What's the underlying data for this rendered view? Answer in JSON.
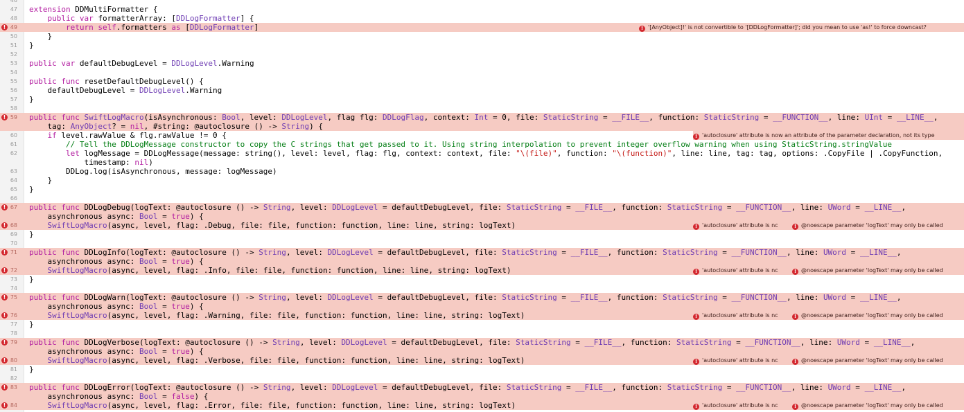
{
  "lines": [
    {
      "n": "46",
      "code": ""
    },
    {
      "n": "47",
      "code": "extension DDMultiFormatter {"
    },
    {
      "n": "48",
      "code": "    public var formatterArray: [DDLogFormatter] {"
    },
    {
      "n": "49",
      "code": "        return self.formatters as [DDLogFormatter]"
    },
    {
      "n": "50",
      "code": "    }"
    },
    {
      "n": "51",
      "code": "}"
    },
    {
      "n": "52",
      "code": ""
    },
    {
      "n": "53",
      "code": "public var defaultDebugLevel = DDLogLevel.Warning"
    },
    {
      "n": "54",
      "code": ""
    },
    {
      "n": "55",
      "code": "public func resetDefaultDebugLevel() {"
    },
    {
      "n": "56",
      "code": "    defaultDebugLevel = DDLogLevel.Warning"
    },
    {
      "n": "57",
      "code": "}"
    },
    {
      "n": "58",
      "code": ""
    },
    {
      "n": "59",
      "code": "public func SwiftLogMacro(isAsynchronous: Bool, level: DDLogLevel, flag flg: DDLogFlag, context: Int = 0, file: StaticString = __FILE__, function: StaticString = __FUNCTION__, line: UInt = __LINE__,"
    },
    {
      "n": "",
      "code": "    tag: AnyObject? = nil, #string: @autoclosure () -> String) {"
    },
    {
      "n": "60",
      "code": "    if level.rawValue & flg.rawValue != 0 {"
    },
    {
      "n": "61",
      "code": "        // Tell the DDLogMessage constructor to copy the C strings that get passed to it. Using string interpolation to prevent integer overflow warning when using StaticString.stringValue"
    },
    {
      "n": "62",
      "code": "        let logMessage = DDLogMessage(message: string(), level: level, flag: flg, context: context, file: \"\\(file)\", function: \"\\(function)\", line: line, tag: tag, options: .CopyFile | .CopyFunction,"
    },
    {
      "n": "",
      "code": "            timestamp: nil)"
    },
    {
      "n": "63",
      "code": "        DDLog.log(isAsynchronous, message: logMessage)"
    },
    {
      "n": "64",
      "code": "    }"
    },
    {
      "n": "65",
      "code": "}"
    },
    {
      "n": "66",
      "code": ""
    },
    {
      "n": "67",
      "code": "public func DDLogDebug(logText: @autoclosure () -> String, level: DDLogLevel = defaultDebugLevel, file: StaticString = __FILE__, function: StaticString = __FUNCTION__, line: UWord = __LINE__,"
    },
    {
      "n": "",
      "code": "    asynchronous async: Bool = true) {"
    },
    {
      "n": "68",
      "code": "    SwiftLogMacro(async, level, flag: .Debug, file: file, function: function, line: line, string: logText)"
    },
    {
      "n": "69",
      "code": "}"
    },
    {
      "n": "70",
      "code": ""
    },
    {
      "n": "71",
      "code": "public func DDLogInfo(logText: @autoclosure () -> String, level: DDLogLevel = defaultDebugLevel, file: StaticString = __FILE__, function: StaticString = __FUNCTION__, line: UWord = __LINE__,"
    },
    {
      "n": "",
      "code": "    asynchronous async: Bool = true) {"
    },
    {
      "n": "72",
      "code": "    SwiftLogMacro(async, level, flag: .Info, file: file, function: function, line: line, string: logText)"
    },
    {
      "n": "73",
      "code": "}"
    },
    {
      "n": "74",
      "code": ""
    },
    {
      "n": "75",
      "code": "public func DDLogWarn(logText: @autoclosure () -> String, level: DDLogLevel = defaultDebugLevel, file: StaticString = __FILE__, function: StaticString = __FUNCTION__, line: UWord = __LINE__,"
    },
    {
      "n": "",
      "code": "    asynchronous async: Bool = true) {"
    },
    {
      "n": "76",
      "code": "    SwiftLogMacro(async, level, flag: .Warning, file: file, function: function, line: line, string: logText)"
    },
    {
      "n": "77",
      "code": "}"
    },
    {
      "n": "78",
      "code": ""
    },
    {
      "n": "79",
      "code": "public func DDLogVerbose(logText: @autoclosure () -> String, level: DDLogLevel = defaultDebugLevel, file: StaticString = __FILE__, function: StaticString = __FUNCTION__, line: UWord = __LINE__,"
    },
    {
      "n": "",
      "code": "    asynchronous async: Bool = true) {"
    },
    {
      "n": "80",
      "code": "    SwiftLogMacro(async, level, flag: .Verbose, file: file, function: function, line: line, string: logText)"
    },
    {
      "n": "81",
      "code": "}"
    },
    {
      "n": "82",
      "code": ""
    },
    {
      "n": "83",
      "code": "public func DDLogError(logText: @autoclosure () -> String, level: DDLogLevel = defaultDebugLevel, file: StaticString = __FILE__, function: StaticString = __FUNCTION__, line: UWord = __LINE__,"
    },
    {
      "n": "",
      "code": "    asynchronous async: Bool = false) {"
    },
    {
      "n": "84",
      "code": "    SwiftLogMacro(async, level, flag: .Error, file: file, function: function, line: line, string: logText)"
    }
  ],
  "error_lines": [
    "49",
    "59",
    "67",
    "68",
    "71",
    "72",
    "75",
    "76",
    "79",
    "80",
    "83",
    "84"
  ],
  "error_icon_glyph": "!",
  "messages": {
    "m49": "'[AnyObject]!' is not convertible to '[DDLogFormatter]'; did you mean to use 'as!' to force downcast?",
    "m60": "'autoclosure' attribute is now an attribute of the parameter declaration, not its type",
    "m_autoclosure_truncated": "'autoclosure' attribute is nc",
    "m_noescape": "@noescape parameter 'logText' may only be called"
  },
  "colors": {
    "keyword": "#b21ca0",
    "type": "#6e3cb3",
    "string": "#c41a16",
    "comment": "#027d13",
    "error_line_bg": "#f6cbc3",
    "error_icon": "#d3282f"
  },
  "icons": {
    "error": "error-circle-icon"
  }
}
